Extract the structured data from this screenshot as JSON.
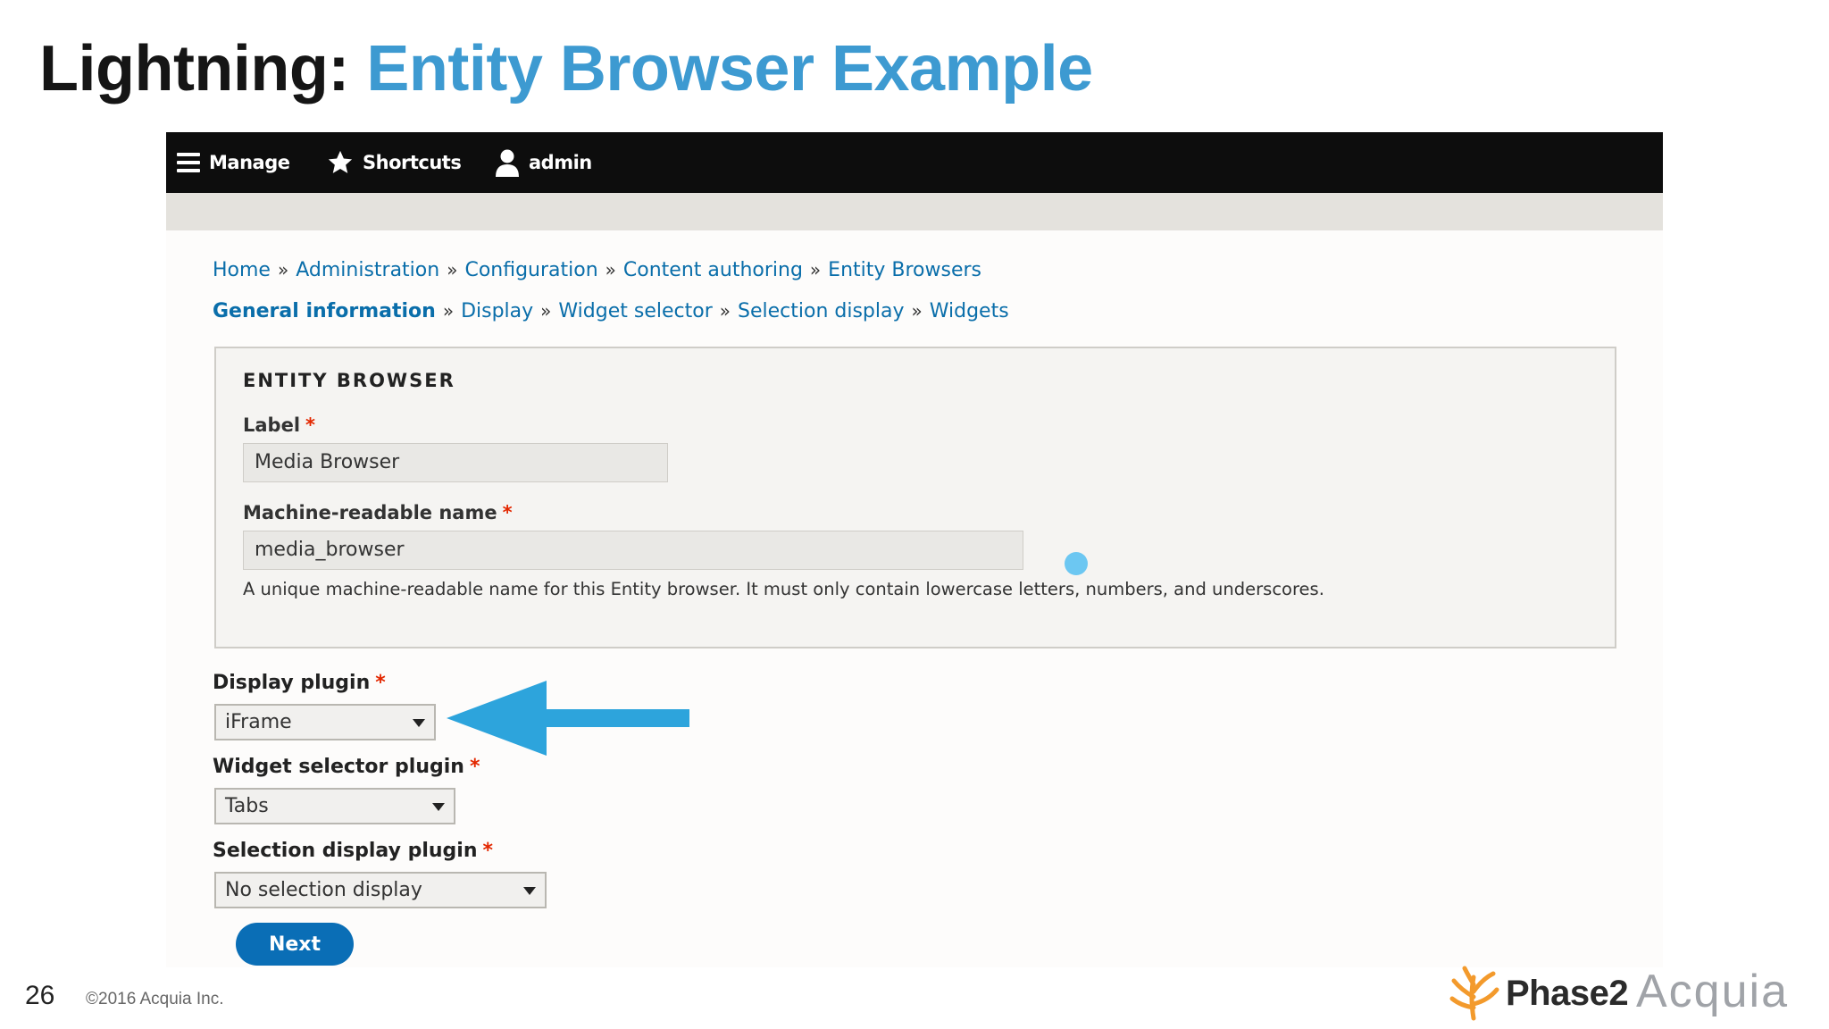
{
  "slide": {
    "title_prefix": "Lightning:",
    "title_accent": "Entity Browser Example",
    "page_number": "26",
    "copyright": "©2016 Acquia Inc.",
    "logos": {
      "phase2": "Phase2",
      "acquia": "Acquia"
    }
  },
  "toolbar": {
    "items": [
      {
        "label": "Manage",
        "icon": "hamburger-menu-icon"
      },
      {
        "label": "Shortcuts",
        "icon": "star-icon"
      },
      {
        "label": "admin",
        "icon": "user-icon"
      }
    ]
  },
  "breadcrumb": {
    "items": [
      "Home",
      "Administration",
      "Configuration",
      "Content authoring",
      "Entity Browsers"
    ],
    "separator": "»"
  },
  "steps": {
    "items": [
      "General information",
      "Display",
      "Widget selector",
      "Selection display",
      "Widgets"
    ],
    "active_index": 0,
    "separator": "»"
  },
  "fieldset": {
    "legend": "ENTITY BROWSER",
    "label_field": {
      "label": "Label",
      "required_marker": "*",
      "value": "Media Browser"
    },
    "machine_name_field": {
      "label": "Machine-readable name",
      "required_marker": "*",
      "value": "media_browser"
    },
    "machine_name_description": "A unique machine-readable name for this Entity browser. It must only contain lowercase letters, numbers, and underscores."
  },
  "plugins": {
    "display": {
      "label": "Display plugin",
      "required_marker": "*",
      "value": "iFrame"
    },
    "widget_selector": {
      "label": "Widget selector plugin",
      "required_marker": "*",
      "value": "Tabs"
    },
    "selection_display": {
      "label": "Selection display plugin",
      "required_marker": "*",
      "value": "No selection display"
    }
  },
  "actions": {
    "next_label": "Next"
  },
  "colors": {
    "title_accent": "#3d9ad1",
    "link": "#0a6eaa",
    "toolbar_bg": "#0d0d0d",
    "required": "#e32700",
    "primary_button": "#0a6eb6",
    "annotation_arrow": "#2da4dc"
  }
}
